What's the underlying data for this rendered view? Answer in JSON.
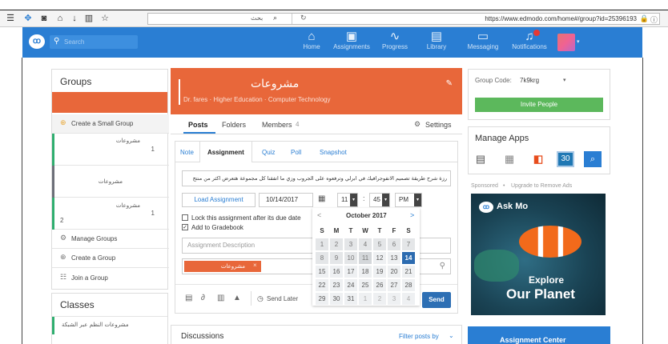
{
  "browser": {
    "search_text": "بحث",
    "url": "https://www.edmodo.com/home#/group?id=25396193"
  },
  "nav": {
    "search_placeholder": "Search",
    "items": [
      {
        "label": "Home",
        "icon": "home-icon"
      },
      {
        "label": "Assignments",
        "icon": "assignments-icon"
      },
      {
        "label": "Progress",
        "icon": "progress-icon"
      },
      {
        "label": "Library",
        "icon": "library-icon"
      },
      {
        "label": "Messaging",
        "icon": "messaging-icon"
      },
      {
        "label": "Notifications",
        "icon": "notifications-icon"
      }
    ]
  },
  "groups": {
    "title": "Groups",
    "create_small": "Create a Small Group",
    "items": [
      {
        "name": "مشروعات",
        "count": "1",
        "color": "#2fae6f"
      },
      {
        "name": "مشروعات",
        "count": "",
        "color": "#6c6f78"
      },
      {
        "name": "مشروعات",
        "count": "1",
        "color": "#2fae6f",
        "sub": "2"
      }
    ],
    "manage": "Manage Groups",
    "create": "Create a Group",
    "join": "Join a Group",
    "classes_title": "Classes",
    "class_item": "مشروعات النظم عبر الشبكة"
  },
  "header": {
    "title": "مشروعات",
    "subtitle": "Dr. fares · Higher Education · Computer Technology",
    "color": "#e8673a"
  },
  "tabs": {
    "posts": "Posts",
    "folders": "Folders",
    "members": "Members",
    "members_count": "4",
    "settings": "Settings"
  },
  "composer": {
    "tabs": [
      "Note",
      "Assignment",
      "Quiz",
      "Poll",
      "Snapshot"
    ],
    "active_tab": "Assignment",
    "assignment_text": "رزة شرح طريقة تصميم الانفوجرافيك في ابرلي وترفعوه على الجروب وزي ما اتفقنا كل مجموعة هتعرض اكثر من منتج",
    "load_button": "Load Assignment",
    "date": "10/14/2017",
    "hour": "11",
    "minute": "45",
    "ampm": "PM",
    "lock_label": "Lock this assignment after its due date",
    "gradebook_label": "Add to Gradebook",
    "description_placeholder": "Assignment Description",
    "recipient_tag": "مشروعات",
    "send_later": "Send Later",
    "send": "Send"
  },
  "calendar": {
    "prev": "<",
    "next": ">",
    "month": "October 2017",
    "weekdays": [
      "S",
      "M",
      "T",
      "W",
      "T",
      "F",
      "S"
    ],
    "weeks": [
      [
        "1",
        "2",
        "3",
        "4",
        "5",
        "6",
        "7"
      ],
      [
        "8",
        "9",
        "10",
        "11",
        "12",
        "13",
        "14"
      ],
      [
        "15",
        "16",
        "17",
        "18",
        "19",
        "20",
        "21"
      ],
      [
        "22",
        "23",
        "24",
        "25",
        "26",
        "27",
        "28"
      ],
      [
        "29",
        "30",
        "31",
        "1",
        "2",
        "3",
        "4"
      ]
    ],
    "selected_day": "14"
  },
  "discussions": {
    "title": "Discussions",
    "filter": "Filter posts by"
  },
  "right": {
    "group_code_label": "Group Code:",
    "group_code": "7k9krg",
    "invite": "Invite People",
    "manage_apps": "Manage Apps",
    "app_calendar_num": "30",
    "sponsored": "Sponsored",
    "upgrade": "Upgrade to Remove Ads",
    "ad_title": "Ask Mo",
    "ad_explore": "Explore",
    "ad_planet": "Our Planet",
    "assignment_center": "Assignment Center"
  },
  "colors": {
    "brand_blue": "#2a7ed3",
    "orange": "#e8673a",
    "green": "#5cb85c",
    "send_blue": "#2d6fb4"
  }
}
